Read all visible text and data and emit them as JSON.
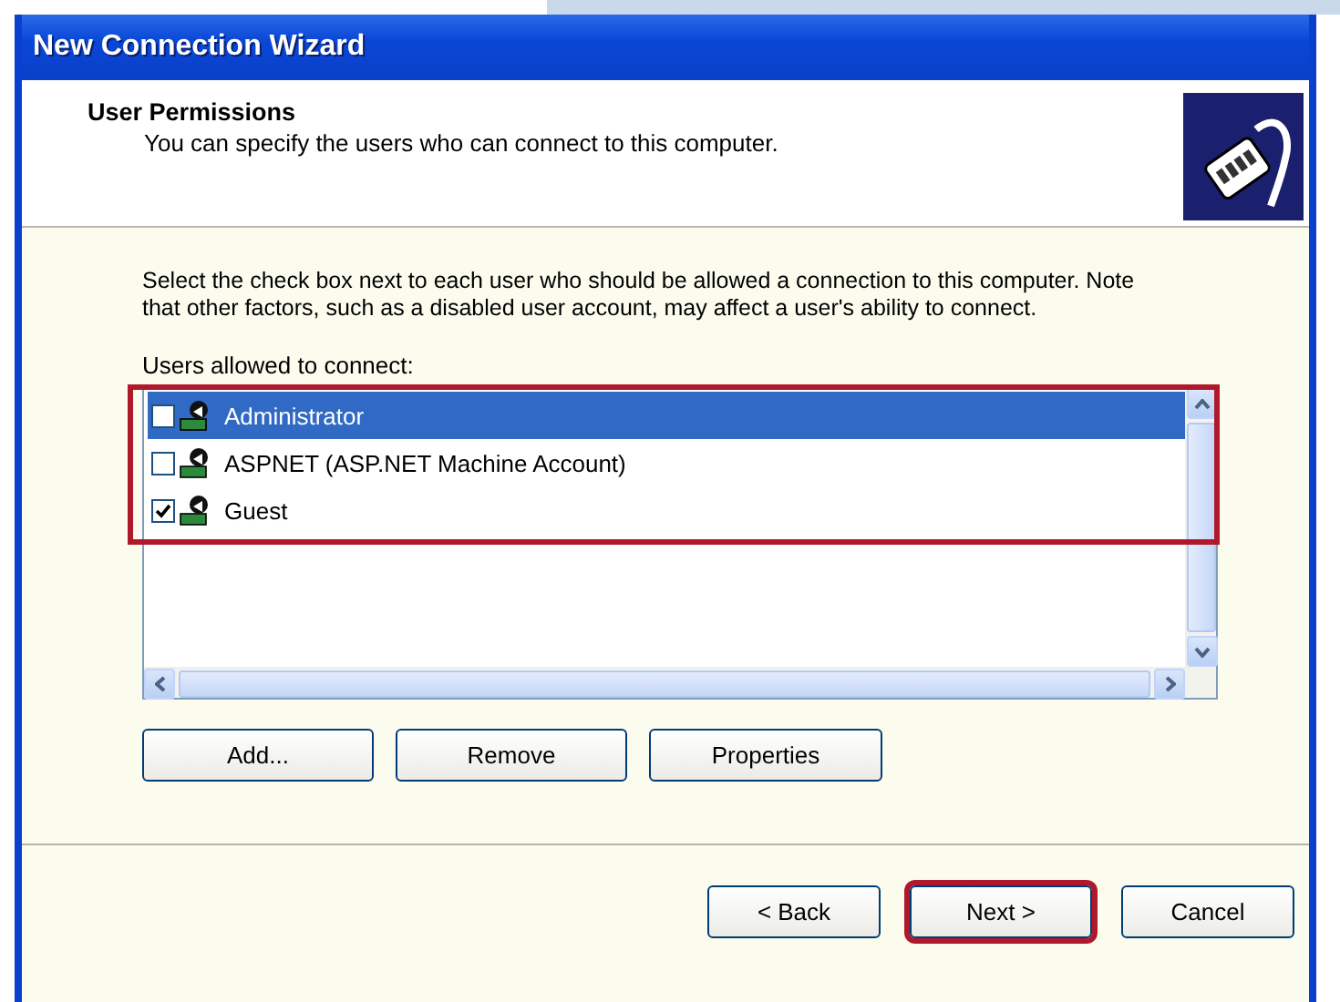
{
  "window": {
    "title": "New Connection Wizard"
  },
  "header": {
    "title": "User Permissions",
    "subtitle": "You can specify the users who can connect to this computer."
  },
  "instructions": "Select the check box next to each user who should be allowed a connection to this computer.  Note that other factors, such as a disabled user account, may affect a user's ability to connect.",
  "users_list": {
    "label": "Users allowed to connect:",
    "highlighted": true,
    "items": [
      {
        "name": "Administrator",
        "checked": false,
        "selected": true
      },
      {
        "name": "ASPNET (ASP.NET Machine Account)",
        "checked": false,
        "selected": false
      },
      {
        "name": "Guest",
        "checked": true,
        "selected": false
      }
    ]
  },
  "list_buttons": [
    {
      "label": "Add..."
    },
    {
      "label": "Remove"
    },
    {
      "label": "Properties"
    }
  ],
  "footer_buttons": [
    {
      "label": "< Back",
      "highlighted": false
    },
    {
      "label": "Next >",
      "highlighted": true
    },
    {
      "label": "Cancel",
      "highlighted": false
    }
  ]
}
